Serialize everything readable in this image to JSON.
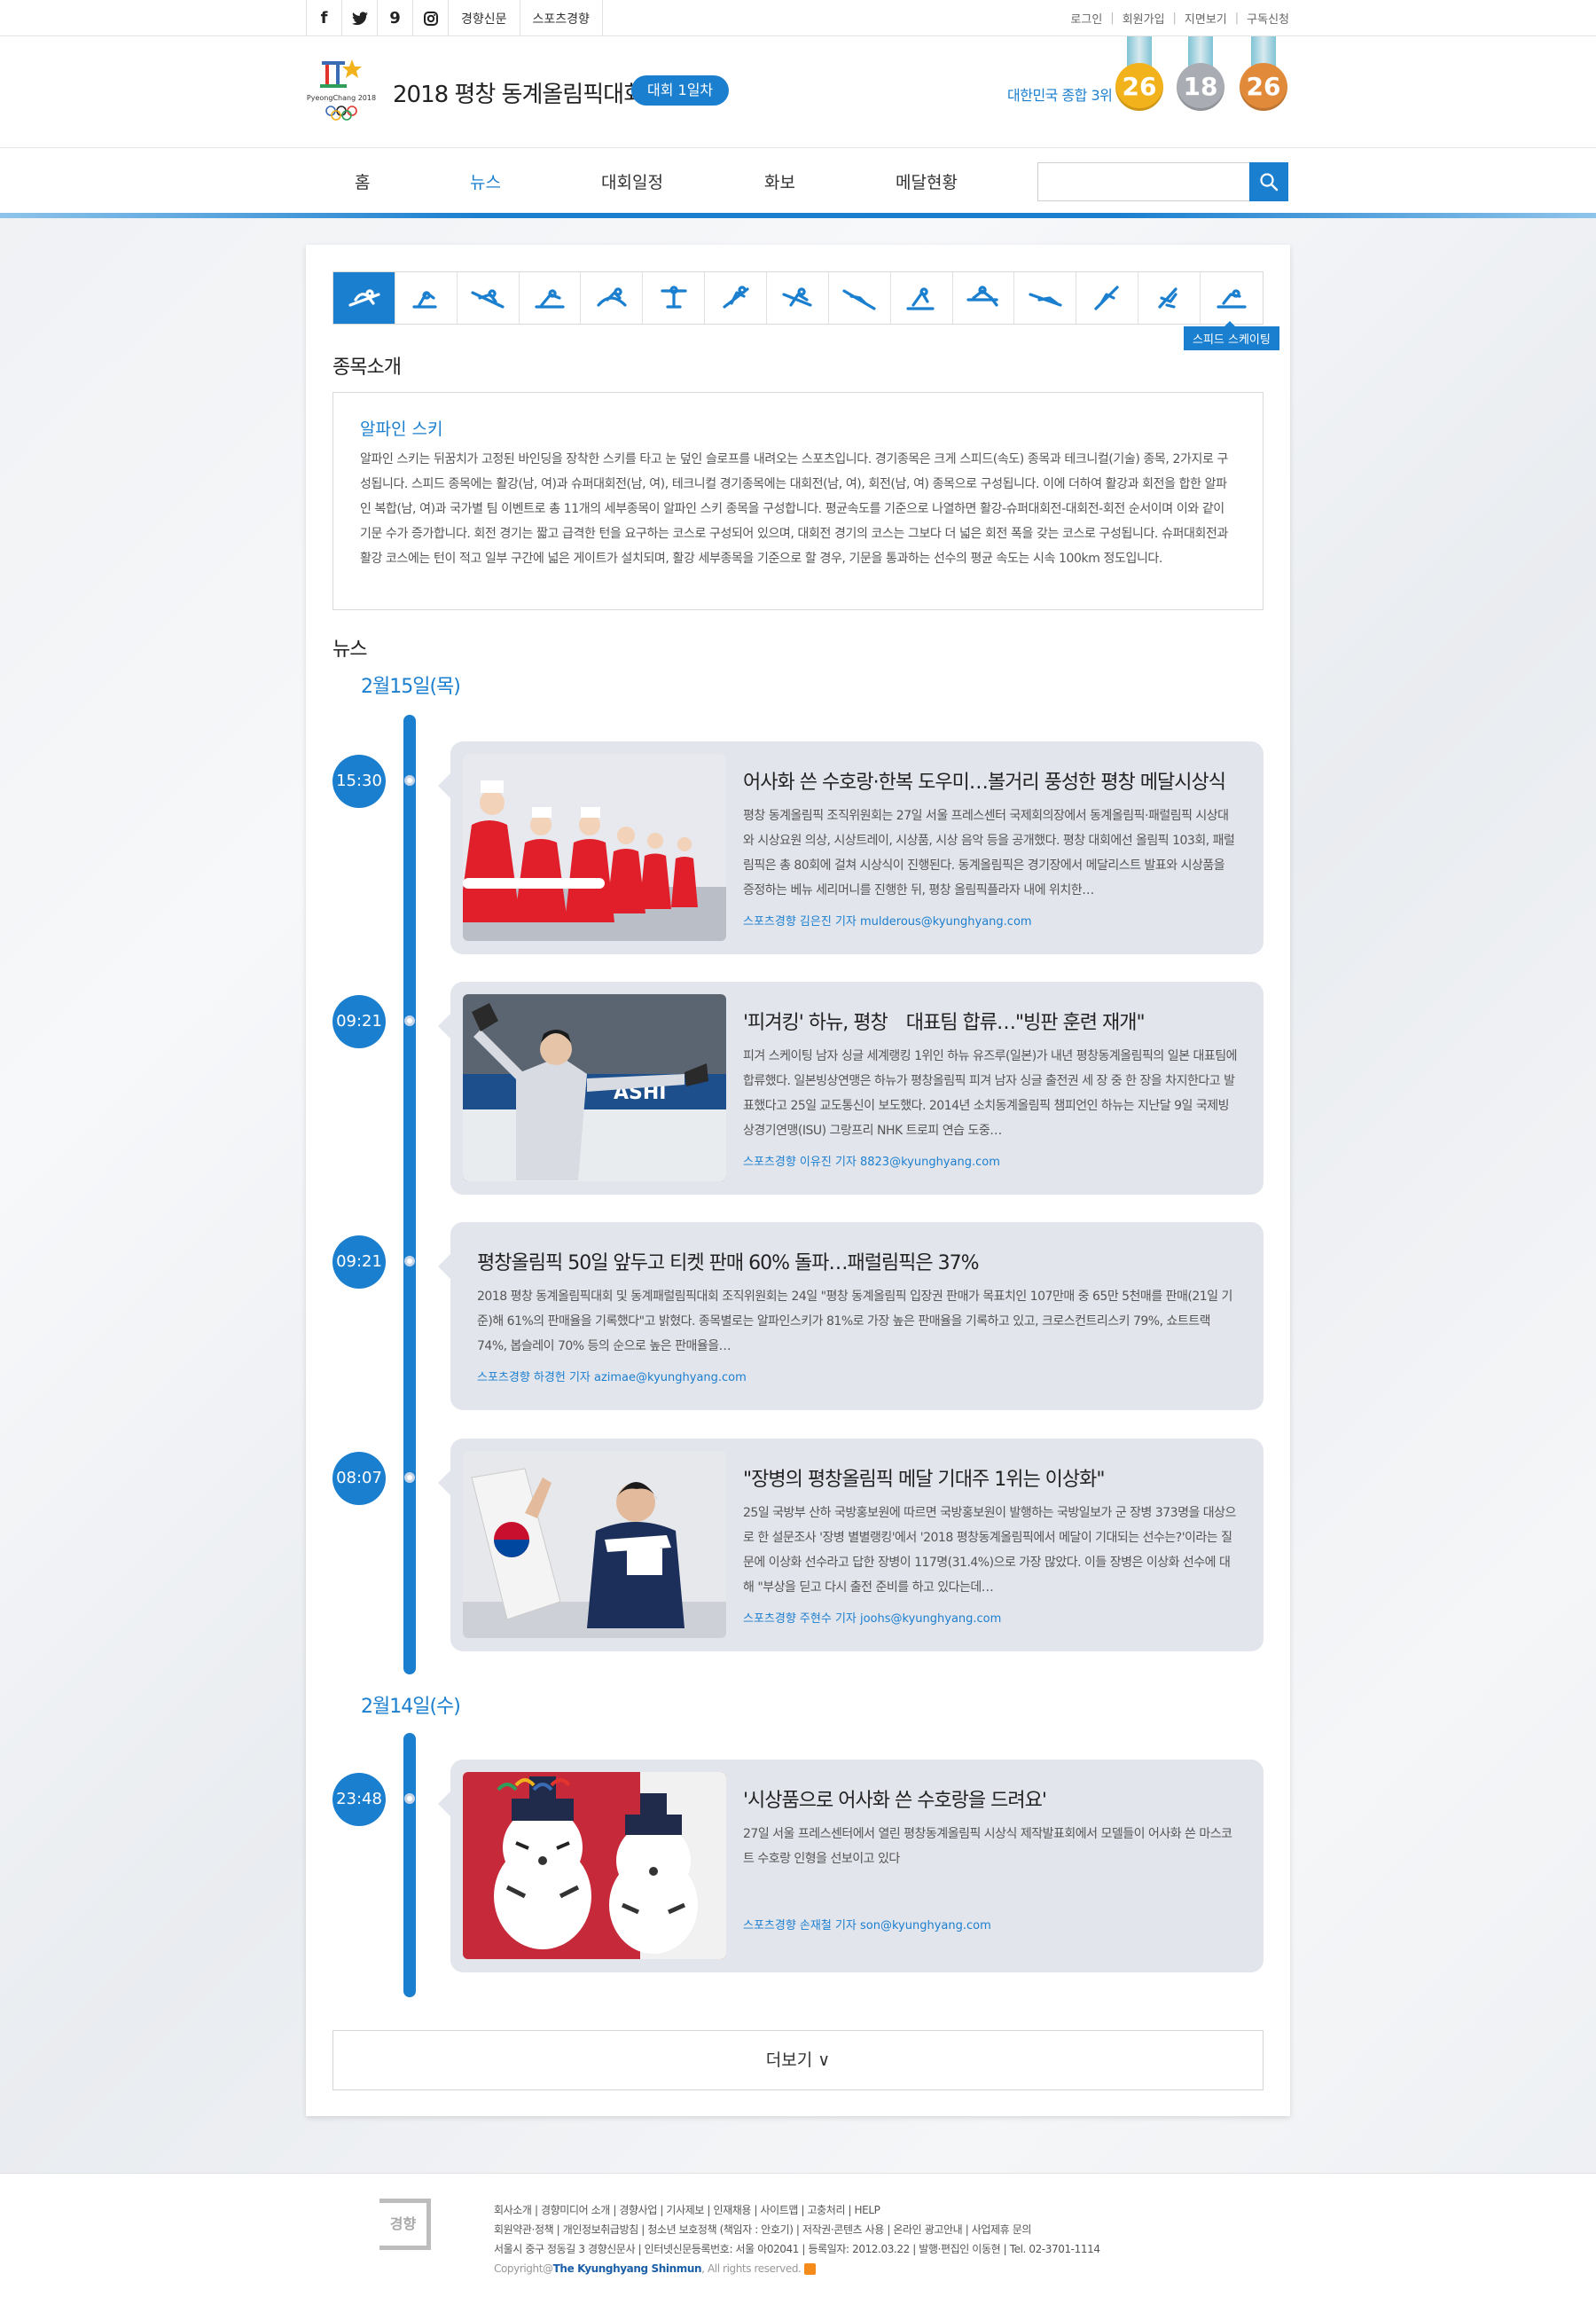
{
  "topbar": {
    "social": [
      {
        "name": "facebook-icon",
        "glyph": "f"
      },
      {
        "name": "twitter-icon",
        "glyph": "t"
      },
      {
        "name": "story-icon",
        "glyph": "9"
      },
      {
        "name": "instagram-icon",
        "glyph": "◎"
      }
    ],
    "links": [
      "경향신문",
      "스포츠경향"
    ],
    "util": [
      "로그인",
      "회원가입",
      "지면보기",
      "구독신청"
    ]
  },
  "header": {
    "title": "2018 평창 동계올림픽대회",
    "day_pill": "대회 1일차",
    "logo_text": "PyeongChang 2018",
    "rank_text": "대한민국 종합 3위",
    "medals": {
      "gold": "26",
      "silver": "18",
      "bronze": "26"
    }
  },
  "nav": {
    "items": [
      "홈",
      "뉴스",
      "대회일정",
      "화보",
      "메달현황"
    ],
    "active": 1,
    "search_placeholder": ""
  },
  "sports": {
    "count": 15,
    "active": 0,
    "tooltip": "스피드 스케이팅"
  },
  "intro": {
    "heading": "종목소개",
    "title": "알파인 스키",
    "body": "알파인 스키는 뒤꿈치가 고정된 바인딩을 장착한 스키를 타고 눈 덮인 슬로프를 내려오는 스포츠입니다. 경기종목은 크게 스피드(속도) 종목과 테크니컬(기술) 종목, 2가지로 구성됩니다. 스피드 종목에는 활강(남, 여)과 슈퍼대회전(남, 여), 테크니컬 경기종목에는 대회전(남, 여), 회전(남, 여) 종목으로 구성됩니다. 이에 더하여 활강과 회전을 합한 알파인 복합(남, 여)과 국가별 팀 이벤트로 총 11개의 세부종목이 알파인 스키 종목을 구성합니다. 평균속도를 기준으로 나열하면 활강-슈퍼대회전-대회전-회전 순서이며 이와 같이 기문 수가 증가합니다. 회전 경기는 짧고 급격한 턴을 요구하는 코스로 구성되어 있으며, 대회전 경기의 코스는 그보다 더 넓은 회전 폭을 갖는 코스로 구성됩니다. 슈퍼대회전과 활강 코스에는 턴이 적고 일부 구간에 넓은 게이트가 설치되며, 활강 세부종목을 기준으로 할 경우, 기문을 통과하는 선수의 평균 속도는 시속 100km 정도입니다."
  },
  "news": {
    "heading": "뉴스",
    "dates": [
      "2월15일(목)",
      "2월14일(수)"
    ],
    "items": [
      {
        "time": "15:30",
        "title": "어사화 쓴 수호랑·한복 도우미…볼거리 풍성한 평창 메달시상식",
        "desc": "평창 동계올림픽 조직위원회는 27일 서울 프레스센터 국제회의장에서 동계올림픽·패럴림픽 시상대와 시상요원 의상, 시상트레이, 시상품, 시상 음악 등을 공개했다. 평창 대회에선 올림픽 103회, 패럴림픽은 총 80회에 걸쳐 시상식이 진행된다. 동계올림픽은 경기장에서 메달리스트 발표와 시상품을 증정하는 베뉴 세리머니를 진행한 뒤, 평창 올림픽플라자 내에 위치한…",
        "byline": "스포츠경향 김은진 기자 mulderous@kyunghyang.com"
      },
      {
        "time": "09:21",
        "title": "'피겨킹' 하뉴, 평창　대표팀 합류…\"빙판 훈련 재개\"",
        "desc": "피겨 스케이팅 남자 싱글 세계랭킹 1위인 하뉴 유즈루(일본)가 내년 평창동계올림픽의 일본 대표팀에 합류했다. 일본빙상연맹은 하뉴가 평창올림픽 피겨 남자 싱글 출전권 세 장 중 한 장을 차지한다고 발표했다고 25일 교도통신이 보도했다. 2014년 소치동계올림픽 챔피언인 하뉴는 지난달 9일 국제빙상경기연맹(ISU) 그랑프리 NHK 트로피 연습 도중…",
        "byline": "스포츠경향 이유진 기자 8823@kyunghyang.com"
      },
      {
        "time": "09:21",
        "title": "평창올림픽 50일 앞두고 티켓 판매 60% 돌파…패럴림픽은 37%",
        "desc": "2018 평창 동계올림픽대회 및 동계패럴림픽대회 조직위원회는 24일 \"평창 동계올림픽 입장권 판매가 목표치인 107만매 중 65만 5천매를 판매(21일 기준)해 61%의 판매율을 기록했다\"고 밝혔다. 종목별로는 알파인스키가 81%로 가장 높은 판매율을 기록하고 있고, 크로스컨트리스키 79%, 쇼트트랙 74%, 봅슬레이 70% 등의 순으로 높은 판매율을…",
        "byline": "스포츠경향 하경헌 기자 azimae@kyunghyang.com"
      },
      {
        "time": "08:07",
        "title": "\"장병의 평창올림픽 메달 기대주 1위는 이상화\"",
        "desc": "25일 국방부 산하 국방홍보원에 따르면 국방홍보원이 발행하는 국방일보가 군 장병 373명을 대상으로 한 설문조사 '장병 별별랭킹'에서 '2018 평창동계올림픽에서 메달이 기대되는 선수는?'이라는 질문에 이상화 선수라고 답한 장병이 117명(31.4%)으로 가장 많았다. 이들 장병은 이상화 선수에 대해 \"부상을 딛고 다시 출전 준비를 하고 있다는데…",
        "byline": "스포츠경향 주현수 기자 joohs@kyunghyang.com"
      },
      {
        "time": "23:48",
        "title": "'시상품으로 어사화 쓴 수호랑을 드려요'",
        "desc": "27일 서울 프레스센터에서 열린 평창동계올림픽 시상식 제작발표회에서 모델들이 어사화 쓴 마스코트 수호랑 인형을 선보이고 있다",
        "byline": "스포츠경향 손재철 기자 son@kyunghyang.com"
      }
    ],
    "more": "더보기 ∨"
  },
  "footer": {
    "logo": "경향",
    "line1": "회사소개 | 경향미디어 소개 | 경향사업 | 기사제보 | 인재채용 | 사이트맵 | 고충처리 | HELP",
    "line2": "회원약관·정책 | 개인정보취급방침 | 청소년 보호정책 (책임자 : 안호기) | 저작권·콘텐츠 사용 | 온라인 광고안내 | 사업제휴 문의",
    "line3": "서울시 중구 정동길 3 경향신문사 | 인터넷신문등록번호: 서울 아02041 | 등록일자: 2012.03.22 | 발행·편집인 이동현 | Tel. 02-3701-1114",
    "copy_pre": "Copyright@",
    "copy_name": "The Kyunghyang Shinmun",
    "copy_post": ", All rights reserved."
  },
  "colors": {
    "accent": "#1b7fcf",
    "gold": "#f2b21b",
    "silver": "#a9adb3",
    "bronze": "#e08a3a",
    "card": "#e3e5ec"
  }
}
